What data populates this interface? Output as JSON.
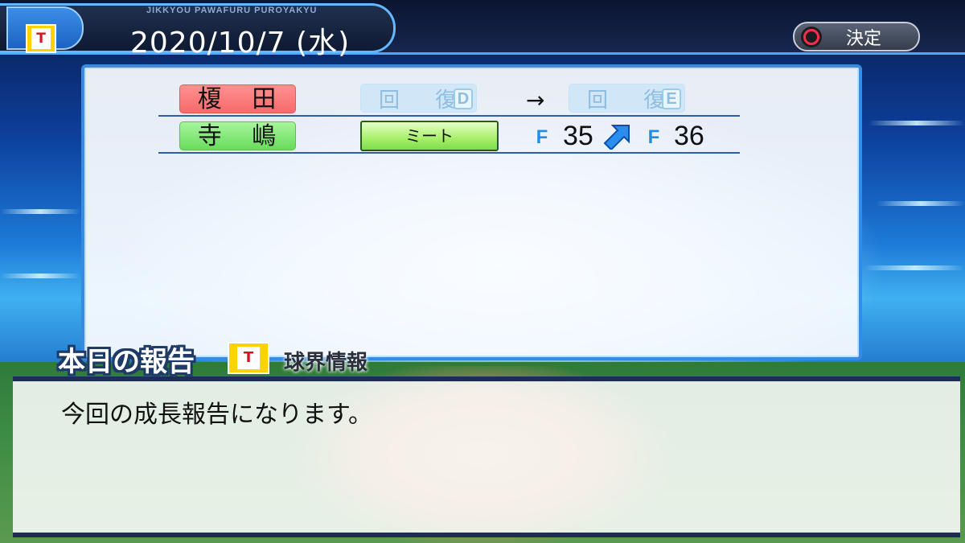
{
  "header": {
    "game_name": "JIKKYOU PAWAFURU PUROYAKYU",
    "date": "2020/10/7 (水)",
    "team_logo_letter": "T",
    "confirm_label": "決定",
    "confirm_icon": "circle-button-icon"
  },
  "report_rows": [
    {
      "player": "榎 田",
      "player_color": "#f76a6a",
      "from_ability": "回 復",
      "from_grade": "D",
      "arrow": "→",
      "to_ability": "回 復",
      "to_grade": "E"
    },
    {
      "player": "寺 嶋",
      "player_color": "#67dc5c",
      "skill": "ミート",
      "from_rank": "F",
      "from_value": "35",
      "change_icon": "up-right-arrow-icon",
      "to_rank": "F",
      "to_value": "36"
    }
  ],
  "report": {
    "title": "本日の報告",
    "team_logo_letter": "T",
    "source": "球界情報",
    "message": "今回の成長報告になります。"
  },
  "colors": {
    "accent": "#3a8ae0",
    "team_yellow": "#ffd200",
    "rank_blue": "#1f8ee8"
  }
}
